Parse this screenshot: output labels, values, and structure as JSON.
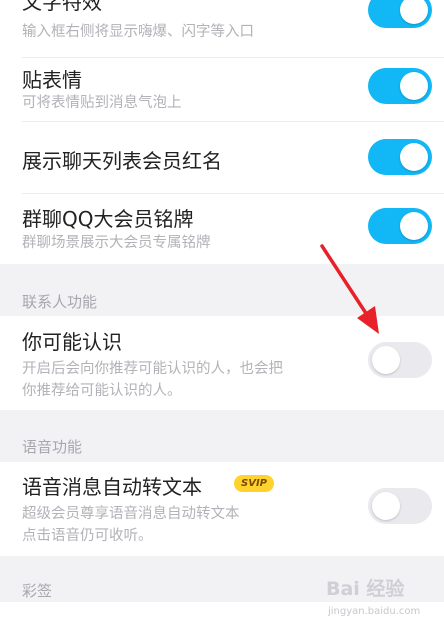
{
  "settings": {
    "text_effects": {
      "title": "文字特效",
      "subtitle": "输入框右侧将显示嗨爆、闪字等入口",
      "enabled": true
    },
    "stickers": {
      "title": "贴表情",
      "subtitle": "可将表情贴到消息气泡上",
      "enabled": true
    },
    "vip_red_name": {
      "title": "展示聊天列表会员红名",
      "enabled": true
    },
    "group_vip_badge": {
      "title": "群聊QQ大会员铭牌",
      "subtitle": "群聊场景展示大会员专属铭牌",
      "enabled": true
    }
  },
  "contacts_section": {
    "label": "联系人功能",
    "may_know": {
      "title": "你可能认识",
      "subtitle_line1": "开启后会向你推荐可能认识的人，也会把",
      "subtitle_line2": "你推荐给可能认识的人。",
      "enabled": false
    }
  },
  "voice_section": {
    "label": "语音功能",
    "auto_transcribe": {
      "title": "语音消息自动转文本",
      "badge": "SVIP",
      "subtitle_line1": "超级会员尊享语音消息自动转文本",
      "subtitle_line2": "点击语音仍可收听。",
      "enabled": false
    }
  },
  "caiqian_section": {
    "label": "彩签"
  },
  "watermark": {
    "logo": "Bai 经验",
    "url": "jingyan.baidu.com"
  },
  "colors": {
    "toggle_on": "#12b7f5",
    "toggle_off": "#e9e9ee",
    "annotation_arrow": "#e8202a",
    "badge": "#ffd22e"
  }
}
